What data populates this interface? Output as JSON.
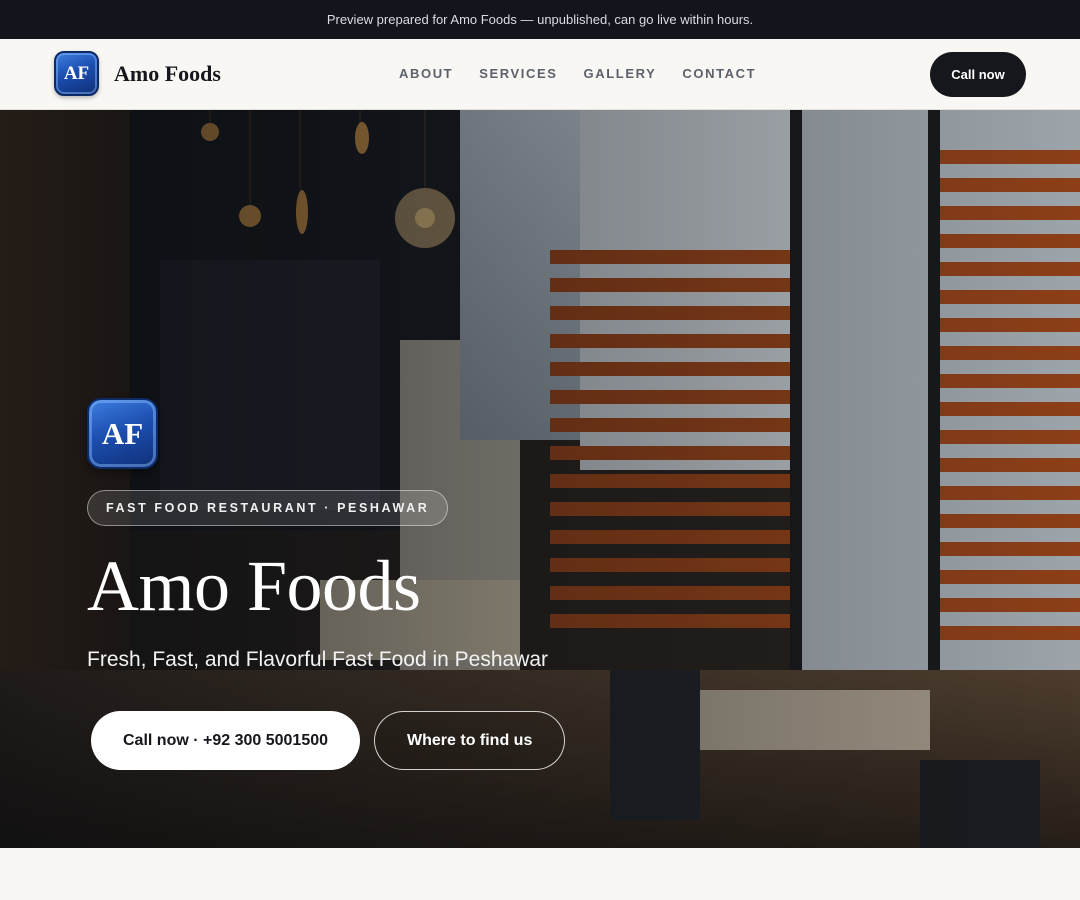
{
  "banner": {
    "text": "Preview prepared for Amo Foods — unpublished, can go live within hours."
  },
  "header": {
    "logo_initials": "AF",
    "brand_name": "Amo Foods",
    "nav": [
      {
        "label": "ABOUT"
      },
      {
        "label": "SERVICES"
      },
      {
        "label": "GALLERY"
      },
      {
        "label": "CONTACT"
      }
    ],
    "cta_label": "Call now"
  },
  "hero": {
    "background": "restaurant-interior-photo",
    "logo_initials": "AF",
    "tag": "FAST FOOD RESTAURANT · PESHAWAR",
    "title": "Amo Foods",
    "subtitle": "Fresh, Fast, and Flavorful Fast Food in Peshawar",
    "primary_button": "Call now · +92 300 5001500",
    "secondary_button": "Where to find us"
  },
  "colors": {
    "banner_bg": "#12151b",
    "header_bg": "#f8f7f3",
    "dark_button": "#15171c",
    "logo_blue": "#1c4fb0"
  }
}
